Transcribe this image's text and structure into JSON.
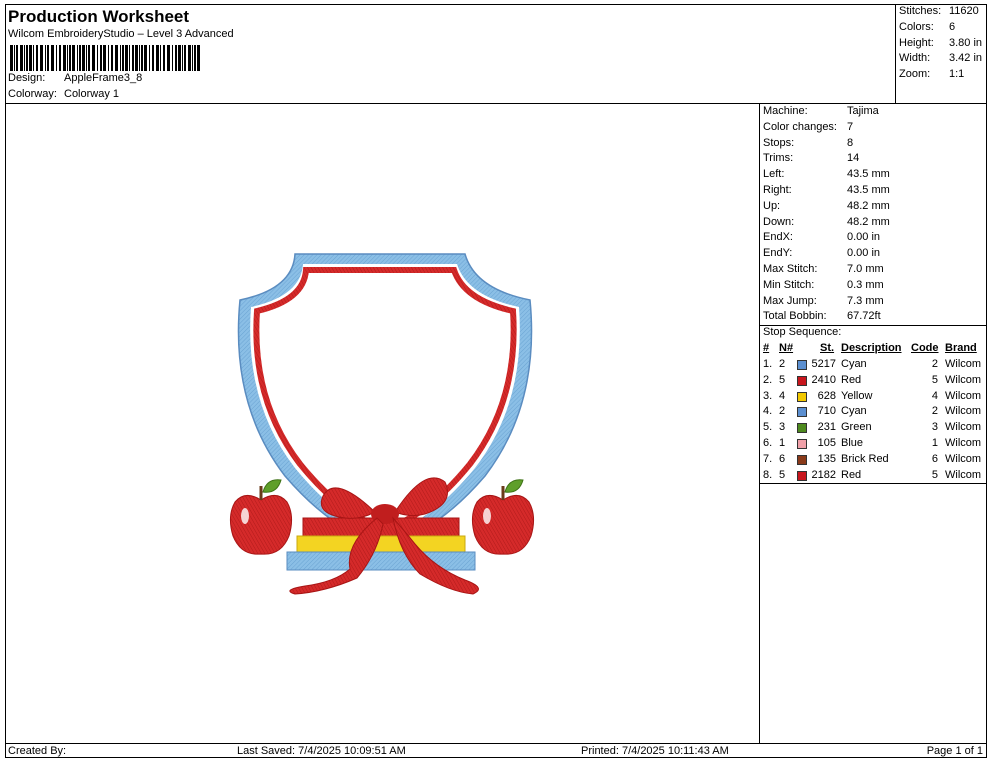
{
  "header": {
    "title": "Production Worksheet",
    "subtitle": "Wilcom EmbroideryStudio – Level 3 Advanced",
    "design_label": "Design:",
    "design_value": "AppleFrame3_8",
    "colorway_label": "Colorway:",
    "colorway_value": "Colorway 1"
  },
  "stats": [
    {
      "k": "Stitches:",
      "v": "11620"
    },
    {
      "k": "Colors:",
      "v": "6"
    },
    {
      "k": "Height:",
      "v": "3.80 in"
    },
    {
      "k": "Width:",
      "v": "3.42 in"
    },
    {
      "k": "Zoom:",
      "v": "1:1"
    }
  ],
  "properties": [
    {
      "k": "Machine:",
      "v": "Tajima"
    },
    {
      "k": "Color changes:",
      "v": "7"
    },
    {
      "k": "Stops:",
      "v": "8"
    },
    {
      "k": "Trims:",
      "v": "14"
    },
    {
      "k": "Left:",
      "v": "43.5 mm"
    },
    {
      "k": "Right:",
      "v": "43.5 mm"
    },
    {
      "k": "Up:",
      "v": "48.2 mm"
    },
    {
      "k": "Down:",
      "v": "48.2 mm"
    },
    {
      "k": "EndX:",
      "v": "0.00 in"
    },
    {
      "k": "EndY:",
      "v": "0.00 in"
    },
    {
      "k": "Max Stitch:",
      "v": "7.0 mm"
    },
    {
      "k": "Min Stitch:",
      "v": "0.3 mm"
    },
    {
      "k": "Max Jump:",
      "v": "7.3 mm"
    },
    {
      "k": "Total Bobbin:",
      "v": "67.72ft"
    }
  ],
  "stop_sequence": {
    "title": "Stop Sequence:",
    "columns": {
      "num": "#",
      "n": "N#",
      "st": "St.",
      "desc": "Description",
      "code": "Code",
      "brand": "Brand"
    },
    "rows": [
      {
        "num": "1.",
        "n": "2",
        "color": "#5b8fd0",
        "st": "5217",
        "desc": "Cyan",
        "code": "2",
        "brand": "Wilcom"
      },
      {
        "num": "2.",
        "n": "5",
        "color": "#c8161d",
        "st": "2410",
        "desc": "Red",
        "code": "5",
        "brand": "Wilcom"
      },
      {
        "num": "3.",
        "n": "4",
        "color": "#f2c800",
        "st": "628",
        "desc": "Yellow",
        "code": "4",
        "brand": "Wilcom"
      },
      {
        "num": "4.",
        "n": "2",
        "color": "#5b8fd0",
        "st": "710",
        "desc": "Cyan",
        "code": "2",
        "brand": "Wilcom"
      },
      {
        "num": "5.",
        "n": "3",
        "color": "#4e8a1e",
        "st": "231",
        "desc": "Green",
        "code": "3",
        "brand": "Wilcom"
      },
      {
        "num": "6.",
        "n": "1",
        "color": "#f0a0a8",
        "st": "105",
        "desc": "Blue",
        "code": "1",
        "brand": "Wilcom"
      },
      {
        "num": "7.",
        "n": "6",
        "color": "#8a3a1a",
        "st": "135",
        "desc": "Brick Red",
        "code": "6",
        "brand": "Wilcom"
      },
      {
        "num": "8.",
        "n": "5",
        "color": "#c8161d",
        "st": "2182",
        "desc": "Red",
        "code": "5",
        "brand": "Wilcom"
      }
    ]
  },
  "footer": {
    "created": "Created By:",
    "saved": "Last Saved: 7/4/2025 10:09:51 AM",
    "printed": "Printed: 7/4/2025 10:11:43 AM",
    "page": "Page 1 of 1"
  },
  "design_colors": {
    "frame_outer": "#8bbfe6",
    "frame_inner": "#d8282a",
    "apple": "#d52a2a",
    "leaf": "#5f9f2a",
    "book_yellow": "#f3d422",
    "book_blue": "#8bbfe6",
    "ribbon": "#d52a2a"
  }
}
